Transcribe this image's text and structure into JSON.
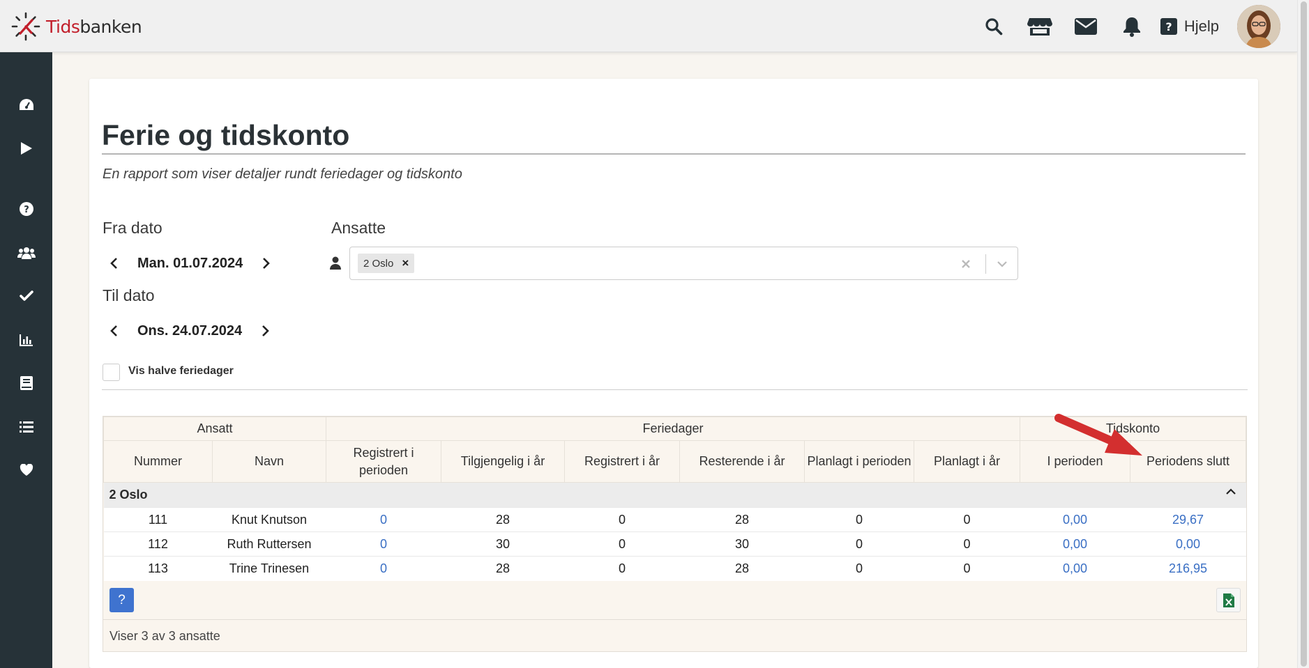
{
  "brand": {
    "part1": "Tids",
    "part2": "banken"
  },
  "topbar": {
    "icons": [
      "search-icon",
      "store-icon",
      "mail-icon",
      "bell-icon"
    ],
    "help_label": "Hjelp"
  },
  "sidebar": {
    "items": [
      "dashboard-icon",
      "play-icon",
      "question-icon",
      "users-icon",
      "check-icon",
      "chart-icon",
      "book-icon",
      "list-icon",
      "heart-icon"
    ]
  },
  "page": {
    "title": "Ferie og tidskonto",
    "subtitle": "En rapport som viser detaljer rundt feriedager og tidskonto"
  },
  "filters": {
    "from_label": "Fra dato",
    "from_value": "Man. 01.07.2024",
    "to_label": "Til dato",
    "to_value": "Ons. 24.07.2024",
    "employees_label": "Ansatte",
    "employees_tag": "2 Oslo",
    "half_days_label": "Vis halve feriedager",
    "half_days_checked": false
  },
  "table": {
    "group_headers": [
      "Ansatt",
      "Feriedager",
      "Tidskonto"
    ],
    "columns": [
      "Nummer",
      "Navn",
      "Registrert i perioden",
      "Tilgjengelig i år",
      "Registrert i år",
      "Resterende i år",
      "Planlagt i perioden",
      "Planlagt i år",
      "I perioden",
      "Periodens slutt"
    ],
    "group_name": "2 Oslo",
    "rows": [
      [
        "111",
        "Knut Knutson",
        "0",
        "28",
        "0",
        "28",
        "0",
        "0",
        "0,00",
        "29,67"
      ],
      [
        "112",
        "Ruth Ruttersen",
        "0",
        "30",
        "0",
        "30",
        "0",
        "0",
        "0,00",
        "0,00"
      ],
      [
        "113",
        "Trine Trinesen",
        "0",
        "28",
        "0",
        "28",
        "0",
        "0",
        "0,00",
        "216,95"
      ]
    ],
    "footer_text": "Viser 3 av 3 ansatte",
    "help_button": "?"
  },
  "colors": {
    "brand_red": "#c21f2b",
    "sidebar": "#263238",
    "link_blue": "#3a6fc4",
    "button_blue": "#3f73cf",
    "annotation_arrow": "#d32f2f"
  }
}
